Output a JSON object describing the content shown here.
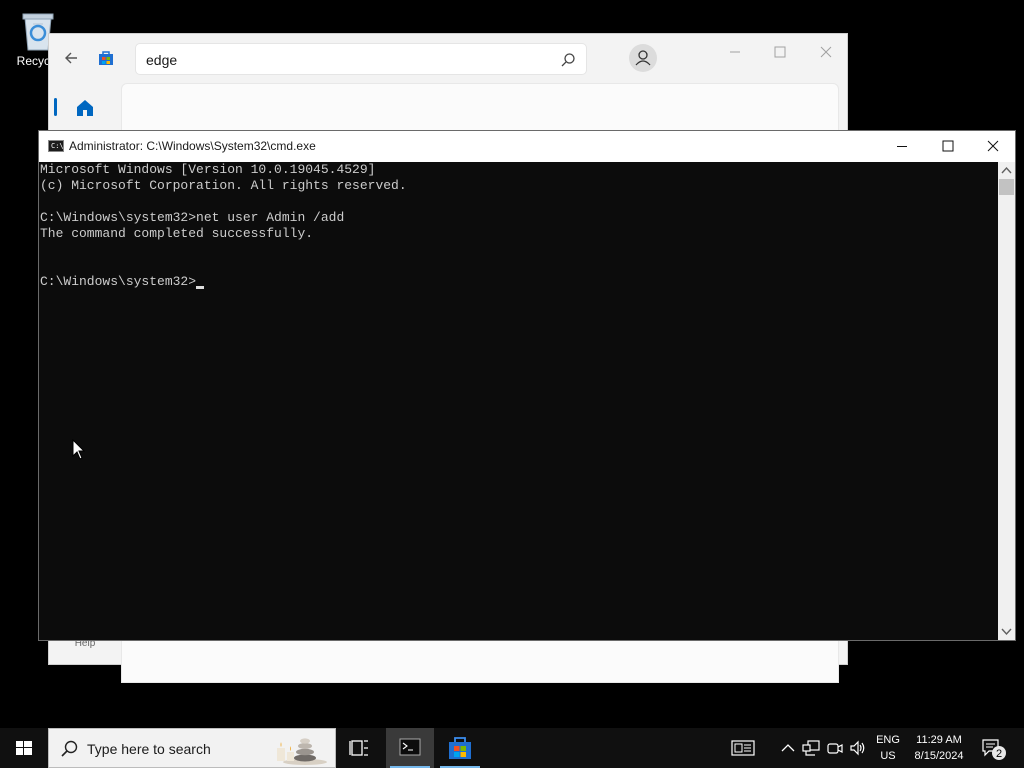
{
  "desktop": {
    "recycle_bin_label": "Recycle"
  },
  "store": {
    "search_value": "edge",
    "help_label": "Help"
  },
  "cmd": {
    "title": "Administrator: C:\\Windows\\System32\\cmd.exe",
    "lines": [
      "Microsoft Windows [Version 10.0.19045.4529]",
      "(c) Microsoft Corporation. All rights reserved.",
      "",
      "C:\\Windows\\system32>net user Admin /add",
      "The command completed successfully.",
      "",
      ""
    ],
    "prompt": "C:\\Windows\\system32>"
  },
  "taskbar": {
    "search_placeholder": "Type here to search",
    "lang_line1": "ENG",
    "lang_line2": "US",
    "time": "11:29 AM",
    "date": "8/15/2024",
    "notification_count": "2",
    "accent_color": "#0067c0"
  }
}
